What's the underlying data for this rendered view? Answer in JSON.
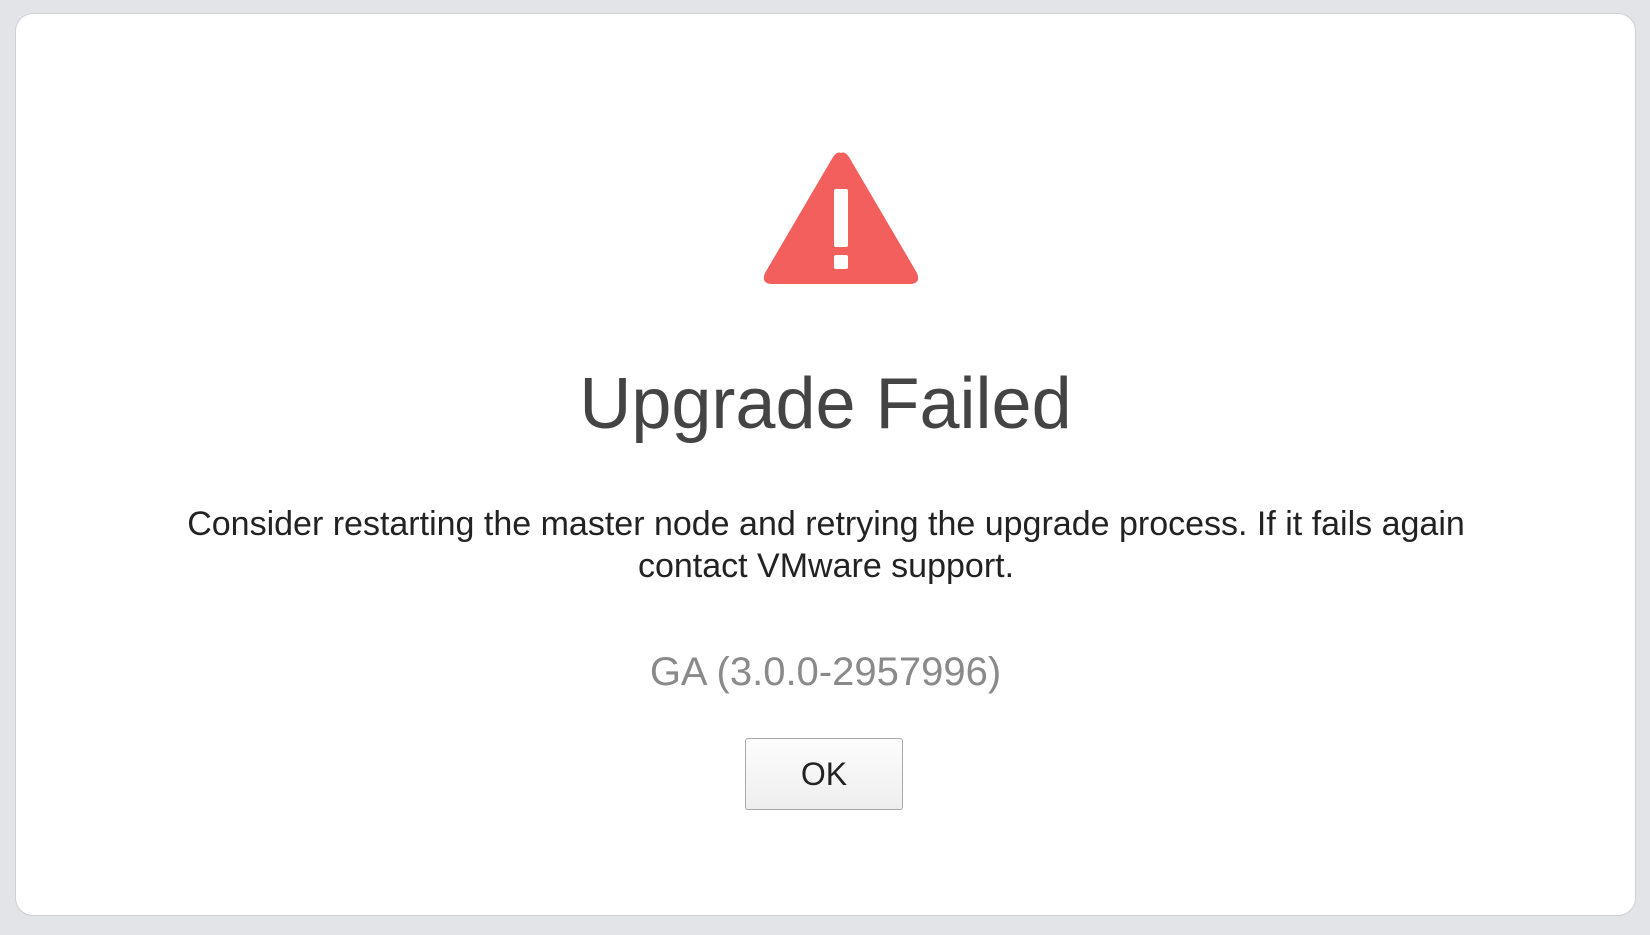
{
  "dialog": {
    "icon": "warning-triangle-icon",
    "icon_color": "#f25f5c",
    "title": "Upgrade Failed",
    "message": "Consider restarting the master node and retrying the upgrade process. If it fails again contact VMware support.",
    "version": "GA (3.0.0-2957996)",
    "ok_label": "OK"
  }
}
